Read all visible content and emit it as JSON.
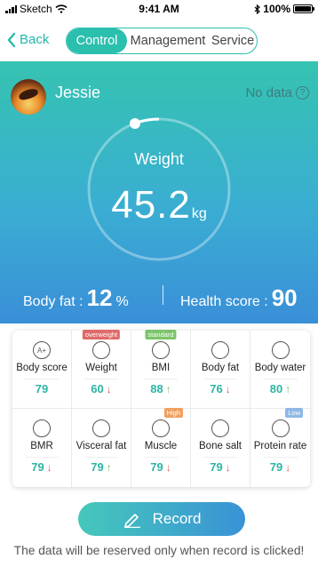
{
  "status_bar": {
    "carrier": "Sketch",
    "time": "9:41 AM",
    "battery": "100%",
    "battery_level": 1.0
  },
  "nav": {
    "back_label": "Back",
    "tabs": [
      {
        "label": "Control",
        "active": true
      },
      {
        "label": "Management",
        "active": false
      },
      {
        "label": "Service",
        "active": false
      }
    ]
  },
  "profile": {
    "name": "Jessie",
    "data_status": "No data",
    "help_icon": "?"
  },
  "weight": {
    "label": "Weight",
    "value": "45.2",
    "unit": "kg"
  },
  "summary": {
    "body_fat_label": "Body fat :",
    "body_fat_value": "12",
    "body_fat_unit": "%",
    "health_score_label": "Health score :",
    "health_score_value": "90"
  },
  "metrics": [
    {
      "name": "Body score",
      "value": "79",
      "icon": "A+",
      "trend": "",
      "badge": ""
    },
    {
      "name": "Weight",
      "value": "60",
      "icon": "scale-icon",
      "trend": "down",
      "badge": "overweight",
      "badge_color": "#e06a6a"
    },
    {
      "name": "BMI",
      "value": "88",
      "icon": "bmi-icon",
      "trend": "up",
      "badge": "standard",
      "badge_color": "#7cc56a"
    },
    {
      "name": "Body fat",
      "value": "76",
      "icon": "fat-icon",
      "trend": "down",
      "badge": ""
    },
    {
      "name": "Body water",
      "value": "80",
      "icon": "water-icon",
      "trend": "up",
      "badge": ""
    },
    {
      "name": "BMR",
      "value": "79",
      "icon": "bmr-icon",
      "trend": "down",
      "badge": ""
    },
    {
      "name": "Visceral fat",
      "value": "79",
      "icon": "visceral-icon",
      "trend": "up",
      "badge": ""
    },
    {
      "name": "Muscle",
      "value": "79",
      "icon": "muscle-icon",
      "trend": "down",
      "badge": "High",
      "badge_color": "#f0a060"
    },
    {
      "name": "Bone salt",
      "value": "79",
      "icon": "bone-icon",
      "trend": "down",
      "badge": ""
    },
    {
      "name": "Protein rate",
      "value": "79",
      "icon": "protein-icon",
      "trend": "down",
      "badge": "Low",
      "badge_color": "#8fb8e6"
    }
  ],
  "record": {
    "label": "Record",
    "icon": "pen-icon"
  },
  "footer_note": "The data will be reserved only when record is clicked!",
  "colors": {
    "accent": "#2bbfae",
    "down": "#e05a5a",
    "up": "#6cc36a"
  }
}
